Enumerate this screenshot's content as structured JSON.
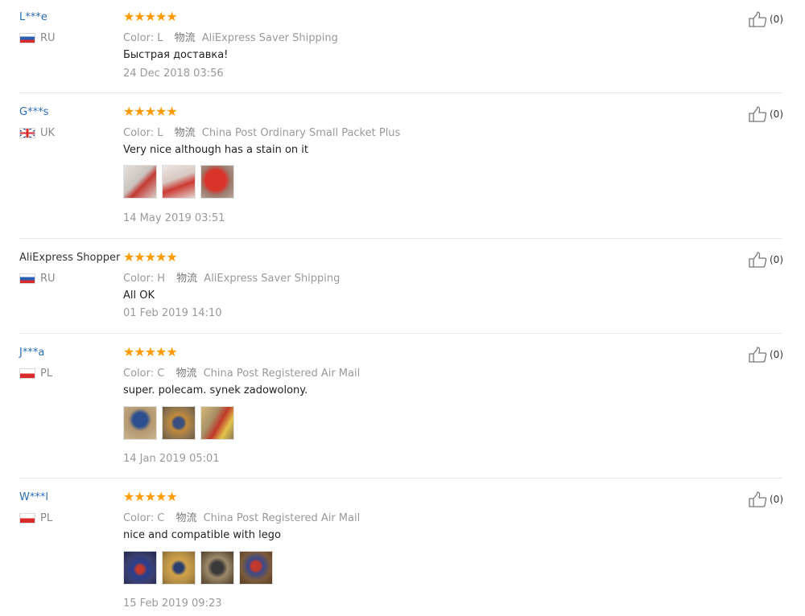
{
  "reviews": [
    {
      "user": "L***e",
      "country": "RU",
      "flag": "ru",
      "rating": 5,
      "stars_text": "★★★★★",
      "color": "Color: L",
      "shipping_label": "物流",
      "shipping": "AliExpress Saver Shipping",
      "text": "Быстрая доставка!",
      "date": "24 Dec 2018 03:56",
      "likes": "(0)",
      "photos": []
    },
    {
      "user": "G***s",
      "country": "UK",
      "flag": "uk",
      "rating": 5,
      "stars_text": "★★★★★",
      "color": "Color: L",
      "shipping_label": "物流",
      "shipping": "China Post Ordinary Small Packet Plus",
      "text": "Very nice although has a stain on it",
      "date": "14 May 2019 03:51",
      "likes": "(0)",
      "photos": [
        "#c9c2bd",
        "#d8c9c4",
        "#b84a3d"
      ]
    },
    {
      "user": "AliExpress Shopper",
      "country": "RU",
      "flag": "ru",
      "rating": 5,
      "stars_text": "★★★★★",
      "color": "Color: H",
      "shipping_label": "物流",
      "shipping": "AliExpress Saver Shipping",
      "text": "All OK",
      "date": "01 Feb 2019 14:10",
      "likes": "(0)",
      "photos": []
    },
    {
      "user": "J***a",
      "country": "PL",
      "flag": "pl",
      "rating": 5,
      "stars_text": "★★★★★",
      "color": "Color: C",
      "shipping_label": "物流",
      "shipping": "China Post Registered Air Mail",
      "text": "super. polecam. synek zadowolony.",
      "date": "14 Jan 2019 05:01",
      "likes": "(0)",
      "photos": [
        "#b39770",
        "#8d7450",
        "#a89066"
      ]
    },
    {
      "user": "W***l",
      "country": "PL",
      "flag": "pl",
      "rating": 5,
      "stars_text": "★★★★★",
      "color": "Color: C",
      "shipping_label": "物流",
      "shipping": "China Post Registered Air Mail",
      "text": "nice and compatible with lego",
      "date": "15 Feb 2019 09:23",
      "likes": "(0)",
      "photos": [
        "#3a3f6e",
        "#b08c45",
        "#6e5d43",
        "#7b5b3a"
      ]
    }
  ]
}
